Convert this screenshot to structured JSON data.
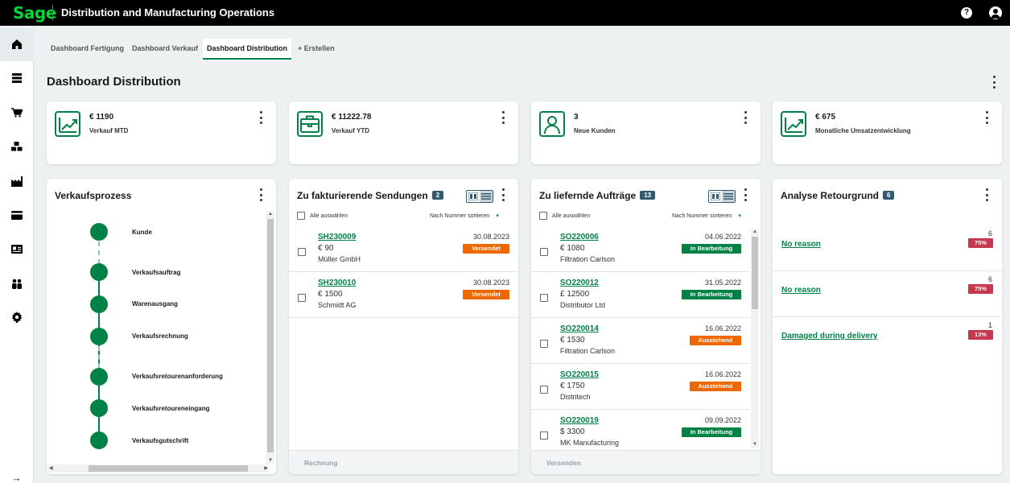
{
  "header": {
    "logo": "Sage",
    "title": "Distribution and Manufacturing Operations",
    "help": "?"
  },
  "nav": {
    "items": [
      {
        "icon": "home-icon"
      },
      {
        "icon": "stack-icon"
      },
      {
        "icon": "cart-icon"
      },
      {
        "icon": "boxes-icon"
      },
      {
        "icon": "factory-icon"
      },
      {
        "icon": "credit-card-icon"
      },
      {
        "icon": "contact-card-icon"
      },
      {
        "icon": "people-icon"
      },
      {
        "icon": "gear-icon"
      }
    ],
    "collapse_arrow": "→"
  },
  "tabs": [
    "Dashboard Fertigung",
    "Dashboard Verkauf",
    "Dashboard Distribution",
    "+ Erstellen"
  ],
  "page": {
    "title": "Dashboard Distribution"
  },
  "kpis": [
    {
      "value": "€ 1190",
      "label": "Verkauf MTD",
      "icon": "chart-up-icon"
    },
    {
      "value": "€ 11222.78",
      "label": "Verkauf YTD",
      "icon": "briefcase-icon"
    },
    {
      "value": "3",
      "label": "Neue Kunden",
      "icon": "person-icon"
    },
    {
      "value": "€ 675",
      "label": "Monatliche Umsatzentwicklung",
      "icon": "chart-up-icon"
    }
  ],
  "process": {
    "title": "Verkaufsprozess",
    "steps": [
      "Kunde",
      "Verkaufsauftrag",
      "Warenausgang",
      "Verkaufsrechnung",
      "Verkaufsretourenanforderung",
      "Verkaufsretoureneingang",
      "Verkaufsgutschrift"
    ]
  },
  "shipments": {
    "title": "Zu fakturierende Sendungen",
    "count": "2",
    "select_all": "Alle auswählen",
    "sort": "Nach Nummer sortieren",
    "footer": "Rechnung",
    "rows": [
      {
        "id": "SH230009",
        "amount": "€ 90",
        "party": "Müller GmbH",
        "date": "30.08.2023",
        "status": "Versendet"
      },
      {
        "id": "SH230010",
        "amount": "€ 1500",
        "party": "Schmidt AG",
        "date": "30.08.2023",
        "status": "Versendet"
      }
    ]
  },
  "orders": {
    "title": "Zu liefernde Aufträge",
    "count": "13",
    "select_all": "Alle auswählen",
    "sort": "Nach Nummer sortieren",
    "footer": "Versenden",
    "rows": [
      {
        "id": "SO220006",
        "amount": "€ 1080",
        "party": "Filtration Carlson",
        "date": "04.06.2022",
        "status": "In Bearbeitung",
        "color": "green"
      },
      {
        "id": "SO220012",
        "amount": "£ 12500",
        "party": "Distributor Ltd",
        "date": "31.05.2022",
        "status": "In Bearbeitung",
        "color": "green"
      },
      {
        "id": "SO220014",
        "amount": "€ 1530",
        "party": "Filtration Carlson",
        "date": "16.06.2022",
        "status": "Ausstehend",
        "color": "orange"
      },
      {
        "id": "SO220015",
        "amount": "€ 1750",
        "party": "Distritech",
        "date": "16.06.2022",
        "status": "Ausstehend",
        "color": "orange"
      },
      {
        "id": "SO220019",
        "amount": "$ 3300",
        "party": "MK Manufacturing",
        "date": "09.09.2022",
        "status": "In Bearbeitung",
        "color": "green"
      }
    ]
  },
  "returns": {
    "title": "Analyse Retourgrund",
    "count": "6",
    "rows": [
      {
        "reason": "No reason",
        "count": "6",
        "pct": "75%"
      },
      {
        "reason": "No reason",
        "count": "6",
        "pct": "75%"
      },
      {
        "reason": "Damaged during delivery",
        "count": "1",
        "pct": "13%"
      }
    ]
  },
  "colors": {
    "accent": "#008146",
    "badge": "#335b70",
    "orange": "#ef6700",
    "red": "#c7384f"
  }
}
